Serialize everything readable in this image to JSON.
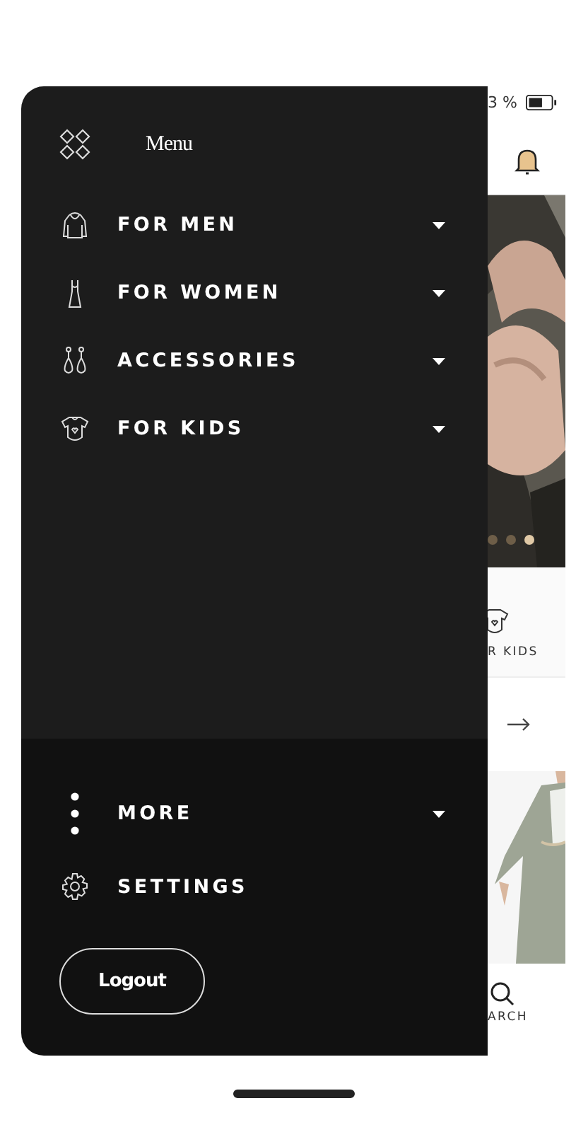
{
  "status_bar": {
    "battery_text": "3 %"
  },
  "background_page": {
    "carousel_dots": [
      {
        "selected": false
      },
      {
        "selected": false
      },
      {
        "selected": true
      }
    ],
    "category_label": "R KIDS",
    "nav_label": "ARCH"
  },
  "menu": {
    "title": "Menu",
    "items": [
      {
        "label": "FOR MEN"
      },
      {
        "label": "FOR WOMEN"
      },
      {
        "label": "ACCESSORIES"
      },
      {
        "label": "FOR KIDS"
      }
    ],
    "footer_items": [
      {
        "label": "MORE",
        "kind": "dropdown"
      },
      {
        "label": "SETTINGS",
        "kind": "link"
      }
    ],
    "logout_button": "Logout"
  }
}
